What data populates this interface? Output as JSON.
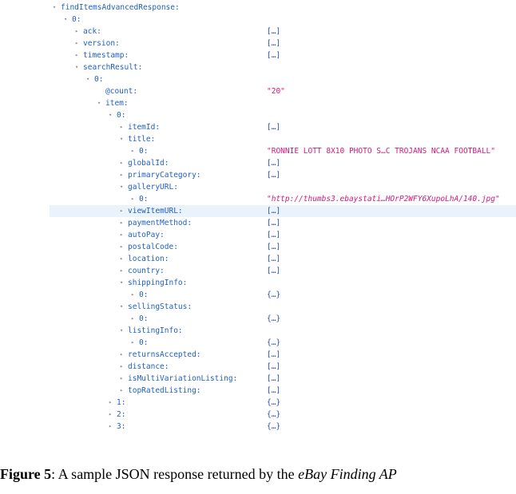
{
  "rows": [
    {
      "indent": 0,
      "tw": "▾",
      "key": "findItemsAdvancedResponse:",
      "val": ""
    },
    {
      "indent": 1,
      "tw": "▾",
      "key": "0:",
      "val": ""
    },
    {
      "indent": 2,
      "tw": "▸",
      "key": "ack:",
      "val": "[…]"
    },
    {
      "indent": 2,
      "tw": "▸",
      "key": "version:",
      "val": "[…]"
    },
    {
      "indent": 2,
      "tw": "▸",
      "key": "timestamp:",
      "val": "[…]"
    },
    {
      "indent": 2,
      "tw": "▾",
      "key": "searchResult:",
      "val": ""
    },
    {
      "indent": 3,
      "tw": "▾",
      "key": "0:",
      "val": ""
    },
    {
      "indent": 4,
      "tw": "",
      "key": "@count:",
      "val": "\"20\"",
      "kind": "str"
    },
    {
      "indent": 4,
      "tw": "▾",
      "key": "item:",
      "val": ""
    },
    {
      "indent": 5,
      "tw": "▾",
      "key": "0:",
      "val": ""
    },
    {
      "indent": 6,
      "tw": "▸",
      "key": "itemId:",
      "val": "[…]"
    },
    {
      "indent": 6,
      "tw": "▾",
      "key": "title:",
      "val": ""
    },
    {
      "indent": 7,
      "tw": "▸",
      "key": "0:",
      "val": "\"RONNIE LOTT 8X10 PHOTO S…C TROJANS NCAA FOOTBALL\"",
      "kind": "str"
    },
    {
      "indent": 6,
      "tw": "▸",
      "key": "globalId:",
      "val": "[…]"
    },
    {
      "indent": 6,
      "tw": "▸",
      "key": "primaryCategory:",
      "val": "[…]"
    },
    {
      "indent": 6,
      "tw": "▾",
      "key": "galleryURL:",
      "val": ""
    },
    {
      "indent": 7,
      "tw": "▸",
      "key": "0:",
      "val": "\"http://thumbs3.ebaystati…HOrP2WFY6XupoLhA/140.jpg\"",
      "kind": "url"
    },
    {
      "indent": 6,
      "tw": "▸",
      "key": "viewItemURL:",
      "val": "[…]",
      "hl": true
    },
    {
      "indent": 6,
      "tw": "▸",
      "key": "paymentMethod:",
      "val": "[…]"
    },
    {
      "indent": 6,
      "tw": "▸",
      "key": "autoPay:",
      "val": "[…]"
    },
    {
      "indent": 6,
      "tw": "▸",
      "key": "postalCode:",
      "val": "[…]"
    },
    {
      "indent": 6,
      "tw": "▸",
      "key": "location:",
      "val": "[…]"
    },
    {
      "indent": 6,
      "tw": "▸",
      "key": "country:",
      "val": "[…]"
    },
    {
      "indent": 6,
      "tw": "▾",
      "key": "shippingInfo:",
      "val": ""
    },
    {
      "indent": 7,
      "tw": "▸",
      "key": "0:",
      "val": "{…}"
    },
    {
      "indent": 6,
      "tw": "▾",
      "key": "sellingStatus:",
      "val": ""
    },
    {
      "indent": 7,
      "tw": "▸",
      "key": "0:",
      "val": "{…}"
    },
    {
      "indent": 6,
      "tw": "▾",
      "key": "listingInfo:",
      "val": ""
    },
    {
      "indent": 7,
      "tw": "▸",
      "key": "0:",
      "val": "{…}"
    },
    {
      "indent": 6,
      "tw": "▸",
      "key": "returnsAccepted:",
      "val": "[…]"
    },
    {
      "indent": 6,
      "tw": "▸",
      "key": "distance:",
      "val": "[…]"
    },
    {
      "indent": 6,
      "tw": "▸",
      "key": "isMultiVariationListing:",
      "val": "[…]"
    },
    {
      "indent": 6,
      "tw": "▸",
      "key": "topRatedListing:",
      "val": "[…]"
    },
    {
      "indent": 5,
      "tw": "▸",
      "key": "1:",
      "val": "{…}"
    },
    {
      "indent": 5,
      "tw": "▸",
      "key": "2:",
      "val": "{…}"
    },
    {
      "indent": 5,
      "tw": "▸",
      "key": "3:",
      "val": "{…}"
    }
  ],
  "caption": {
    "label": "Figure 5",
    "text": ": A sample JSON response returned by the ",
    "italic": "eBay Finding AP"
  },
  "colors": {
    "key": "#1f5fbf",
    "string": "#d6177a",
    "collapsed": "#2a4fa0",
    "highlight": "#eaf2fb"
  }
}
